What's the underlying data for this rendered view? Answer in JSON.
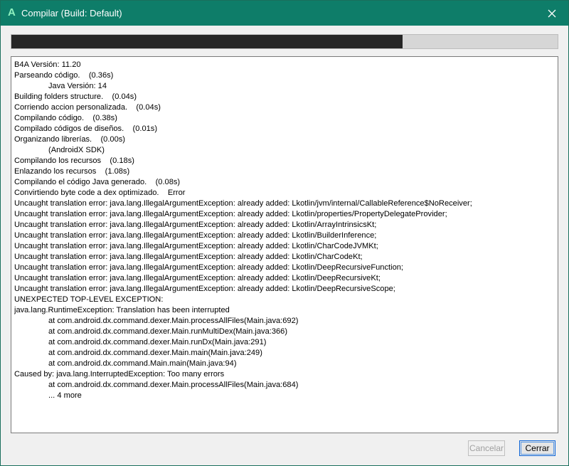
{
  "window": {
    "app_icon_glyph": "A",
    "title": "Compilar (Build: Default)",
    "close_glyph": "✕"
  },
  "progress": {
    "fraction": 0.716
  },
  "log_lines": [
    {
      "text": "B4A Versión: 11.20",
      "indent": false
    },
    {
      "text": "Parseando código.    (0.36s)",
      "indent": false
    },
    {
      "text": "Java Versión: 14",
      "indent": true
    },
    {
      "text": "Building folders structure.    (0.04s)",
      "indent": false
    },
    {
      "text": "Corriendo accion personalizada.    (0.04s)",
      "indent": false
    },
    {
      "text": "Compilando código.    (0.38s)",
      "indent": false
    },
    {
      "text": "Compilado códigos de diseños.    (0.01s)",
      "indent": false
    },
    {
      "text": "Organizando librerías.    (0.00s)",
      "indent": false
    },
    {
      "text": "(AndroidX SDK)",
      "indent": true
    },
    {
      "text": "Compilando los recursos    (0.18s)",
      "indent": false
    },
    {
      "text": "Enlazando los recursos    (1.08s)",
      "indent": false
    },
    {
      "text": "Compilando el código Java generado.    (0.08s)",
      "indent": false
    },
    {
      "text": "Convirtiendo byte code a dex optimizado.    Error",
      "indent": false
    },
    {
      "text": "Uncaught translation error: java.lang.IllegalArgumentException: already added: Lkotlin/jvm/internal/CallableReference$NoReceiver;",
      "indent": false
    },
    {
      "text": "Uncaught translation error: java.lang.IllegalArgumentException: already added: Lkotlin/properties/PropertyDelegateProvider;",
      "indent": false
    },
    {
      "text": "Uncaught translation error: java.lang.IllegalArgumentException: already added: Lkotlin/ArrayIntrinsicsKt;",
      "indent": false
    },
    {
      "text": "Uncaught translation error: java.lang.IllegalArgumentException: already added: Lkotlin/BuilderInference;",
      "indent": false
    },
    {
      "text": "Uncaught translation error: java.lang.IllegalArgumentException: already added: Lkotlin/CharCodeJVMKt;",
      "indent": false
    },
    {
      "text": "Uncaught translation error: java.lang.IllegalArgumentException: already added: Lkotlin/CharCodeKt;",
      "indent": false
    },
    {
      "text": "Uncaught translation error: java.lang.IllegalArgumentException: already added: Lkotlin/DeepRecursiveFunction;",
      "indent": false
    },
    {
      "text": "Uncaught translation error: java.lang.IllegalArgumentException: already added: Lkotlin/DeepRecursiveKt;",
      "indent": false
    },
    {
      "text": "Uncaught translation error: java.lang.IllegalArgumentException: already added: Lkotlin/DeepRecursiveScope;",
      "indent": false
    },
    {
      "text": "UNEXPECTED TOP-LEVEL EXCEPTION:",
      "indent": false
    },
    {
      "text": "java.lang.RuntimeException: Translation has been interrupted",
      "indent": false
    },
    {
      "text": "at com.android.dx.command.dexer.Main.processAllFiles(Main.java:692)",
      "indent": true
    },
    {
      "text": "at com.android.dx.command.dexer.Main.runMultiDex(Main.java:366)",
      "indent": true
    },
    {
      "text": "at com.android.dx.command.dexer.Main.runDx(Main.java:291)",
      "indent": true
    },
    {
      "text": "at com.android.dx.command.dexer.Main.main(Main.java:249)",
      "indent": true
    },
    {
      "text": "at com.android.dx.command.Main.main(Main.java:94)",
      "indent": true
    },
    {
      "text": "Caused by: java.lang.InterruptedException: Too many errors",
      "indent": false
    },
    {
      "text": "at com.android.dx.command.dexer.Main.processAllFiles(Main.java:684)",
      "indent": true
    },
    {
      "text": "... 4 more",
      "indent": true
    }
  ],
  "buttons": {
    "cancel_label": "Cancelar",
    "close_label": "Cerrar"
  },
  "colors": {
    "titlebar": "#0e7d69",
    "progress_fill": "#262626",
    "progress_track": "#d6d6d6"
  }
}
